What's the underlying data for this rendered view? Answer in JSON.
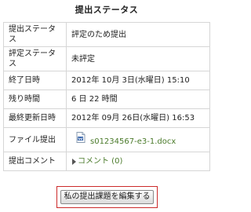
{
  "title": "提出ステータス",
  "rows": [
    {
      "label": "提出ステータス",
      "value": "評定のため提出"
    },
    {
      "label": "評定ステータス",
      "value": "未評定"
    },
    {
      "label": "終了日時",
      "value": "2012年 10月 3日(水曜日) 15:10"
    },
    {
      "label": "残り時間",
      "value": "6 日 22 時間"
    },
    {
      "label": "最終更新日時",
      "value": "2012年 09月 26日(水曜日) 16:53"
    },
    {
      "label": "ファイル提出",
      "file_name": "s01234567-e3-1.docx",
      "file_icon": "word-document-icon"
    },
    {
      "label": "提出コメント",
      "comment_link": "コメント (0)",
      "toggle_icon": "triangle-right-icon"
    }
  ],
  "edit_button": {
    "label": "私の提出課題を編集する"
  },
  "colors": {
    "link": "#4a7a2a",
    "highlight_frame": "#cc2a2a",
    "border": "#d6d6d6"
  }
}
